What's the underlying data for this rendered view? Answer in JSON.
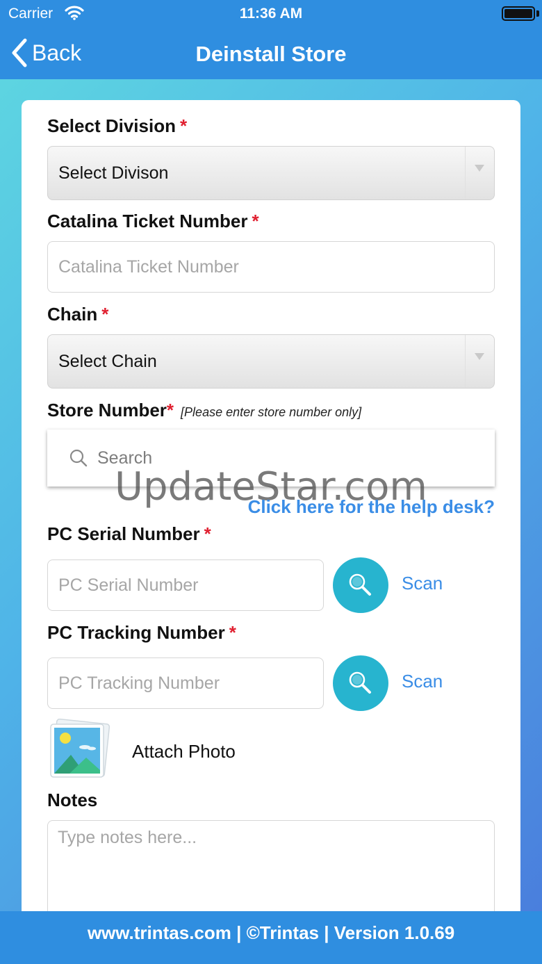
{
  "status_bar": {
    "carrier": "Carrier",
    "time": "11:36 AM"
  },
  "nav": {
    "back_label": "Back",
    "title": "Deinstall Store"
  },
  "form": {
    "division": {
      "label": "Select Division",
      "required": "*",
      "value": "Select Divison"
    },
    "ticket": {
      "label": "Catalina Ticket Number",
      "required": "*",
      "placeholder": "Catalina Ticket Number"
    },
    "chain": {
      "label": "Chain",
      "required": "*",
      "value": "Select Chain"
    },
    "store": {
      "label": "Store Number",
      "required": "*",
      "hint": "[Please enter store number only]",
      "search_placeholder": "Search"
    },
    "help_link": "Click here for the help desk?",
    "pc_serial": {
      "label": "PC Serial Number",
      "required": "*",
      "placeholder": "PC Serial Number",
      "scan_label": "Scan"
    },
    "pc_tracking": {
      "label": "PC Tracking Number",
      "required": "*",
      "placeholder": "PC Tracking Number",
      "scan_label": "Scan"
    },
    "attach_photo": "Attach Photo",
    "notes": {
      "label": "Notes",
      "placeholder": "Type notes here..."
    }
  },
  "watermark": "UpdateStar.com",
  "footer": "www.trintas.com | ©Trintas | Version 1.0.69",
  "colors": {
    "header_blue": "#2f8ee0",
    "required_red": "#e02030",
    "link_blue": "#3a8de6",
    "scan_teal": "#27b4cf"
  }
}
